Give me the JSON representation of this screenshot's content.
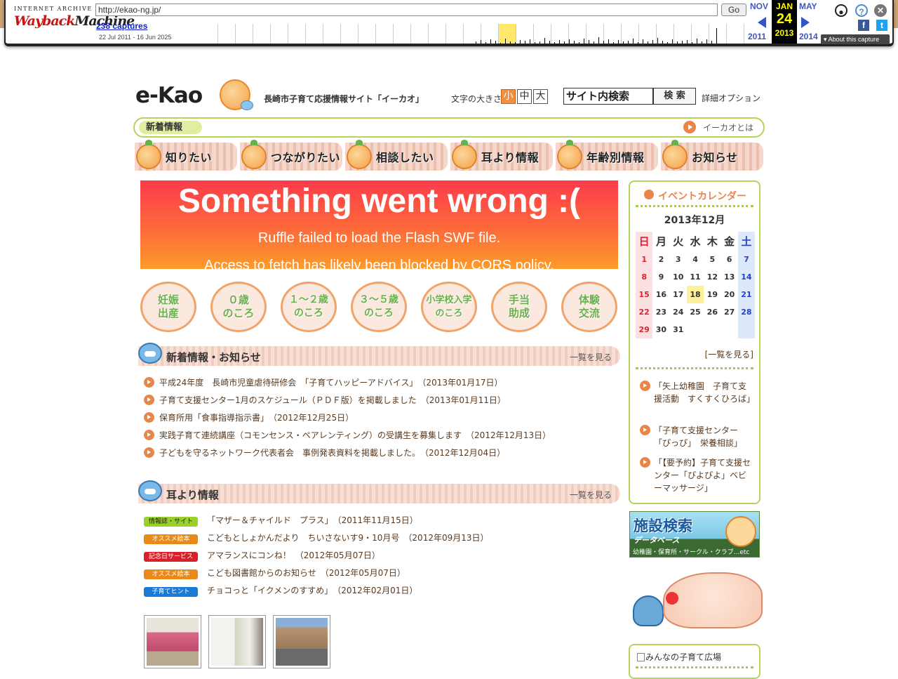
{
  "wayback": {
    "ia_label": "INTERNET ARCHIVE",
    "logo_a": "Wayback",
    "logo_b": "Machine",
    "url": "http://ekao-ng.jp/",
    "go": "Go",
    "captures": "238 captures",
    "range": "22 Jul 2011 - 16 Jun 2025",
    "prev_month": "NOV",
    "prev_year": "2011",
    "cur_month": "JAN",
    "cur_day": "24",
    "cur_year": "2013",
    "next_month": "MAY",
    "next_year": "2014",
    "about": "About this capture"
  },
  "header": {
    "logo": "e-Kao",
    "tagline": "長崎市子育て応援情報サイト「イーカオ」",
    "fontsize_label": "文字の大きさ",
    "fontsize": [
      "小",
      "中",
      "大"
    ],
    "search_value": "サイト内検索",
    "search_button": "検 索",
    "search_options": "詳細オプション"
  },
  "newsbar": {
    "tag": "新着情報",
    "about": "イーカオとは"
  },
  "nav": [
    "知りたい",
    "つながりたい",
    "相談したい",
    "耳より情報",
    "年齢別情報",
    "お知らせ"
  ],
  "flash": {
    "title": "Something went wrong :(",
    "line1": "Ruffle failed to load the Flash SWF file.",
    "line2": "Access to fetch has likely been blocked by CORS policy."
  },
  "ages": [
    {
      "l1": "妊娠",
      "l2": "出産"
    },
    {
      "l1": "０歳",
      "l2": "のころ"
    },
    {
      "l1": "１～２歳",
      "l2": "のころ"
    },
    {
      "l1": "３～５歳",
      "l2": "のころ"
    },
    {
      "l1": "小学校入学",
      "l2": "のころ"
    },
    {
      "l1": "手当",
      "l2": "助成"
    },
    {
      "l1": "体験",
      "l2": "交流"
    }
  ],
  "news": {
    "title": "新着情報・お知らせ",
    "more": "一覧を見る",
    "items": [
      "平成24年度　長崎市児童虐待研修会　「子育てハッピーアドバイス」　（2013年01月17日）",
      "子育て支援センター1月のスケジュール（ＰＤＦ版）を掲載しました　（2013年01月11日）",
      "保育所用「食事指導指示書」　（2012年12月25日）",
      "実践子育て連続講座（コモンセンス・ペアレンティング）の受講生を募集します　（2012年12月13日）",
      "子どもを守るネットワーク代表者会　事例発表資料を掲載しました。　（2012年12月04日）"
    ]
  },
  "ear": {
    "title": "耳より情報",
    "more": "一覧を見る",
    "items": [
      {
        "badge": "情報誌・サイト",
        "color": "#9ad02a",
        "text": "「マザー＆チャイルド　プラス」　（2011年11月15日）"
      },
      {
        "badge": "オススメ絵本",
        "color": "#e88a1a",
        "text": "こどもとしょかんだより　ちいさないす9・10月号　（2012年09月13日）"
      },
      {
        "badge": "記念日サービス",
        "color": "#d8202a",
        "text": "アマランスにコンね！　（2012年05月07日）"
      },
      {
        "badge": "オススメ絵本",
        "color": "#e88a1a",
        "text": "こども図書館からのお知らせ　（2012年05月07日）"
      },
      {
        "badge": "子育てヒント",
        "color": "#1a7ad8",
        "text": "チョコっと「イクメンのすすめ」　（2012年02月01日）"
      }
    ]
  },
  "calendar": {
    "title": "イベントカレンダー",
    "month": "2013年12月",
    "weekdays": [
      "日",
      "月",
      "火",
      "水",
      "木",
      "金",
      "土"
    ],
    "weeks": [
      [
        "1",
        "2",
        "3",
        "4",
        "5",
        "6",
        "7"
      ],
      [
        "8",
        "9",
        "10",
        "11",
        "12",
        "13",
        "14"
      ],
      [
        "15",
        "16",
        "17",
        "18",
        "19",
        "20",
        "21"
      ],
      [
        "22",
        "23",
        "24",
        "25",
        "26",
        "27",
        "28"
      ],
      [
        "29",
        "30",
        "31",
        "",
        "",
        "",
        ""
      ]
    ],
    "today": "18",
    "list_more": "[一覧を見る]",
    "events": [
      "「矢上幼稚園　子育て支援活動　すくすくひろば」",
      "「子育て支援センター「ぴっぴ」　栄養相談」",
      "「【要予約】子育て支援センター「ぴよぴよ」ベビーマッサージ」"
    ]
  },
  "facility": {
    "title": "施設検索",
    "sub": "データベース",
    "caption": "幼稚園・保育所・サークル・クラブ...etc"
  },
  "square": {
    "title": "みんなの子育て広場"
  }
}
